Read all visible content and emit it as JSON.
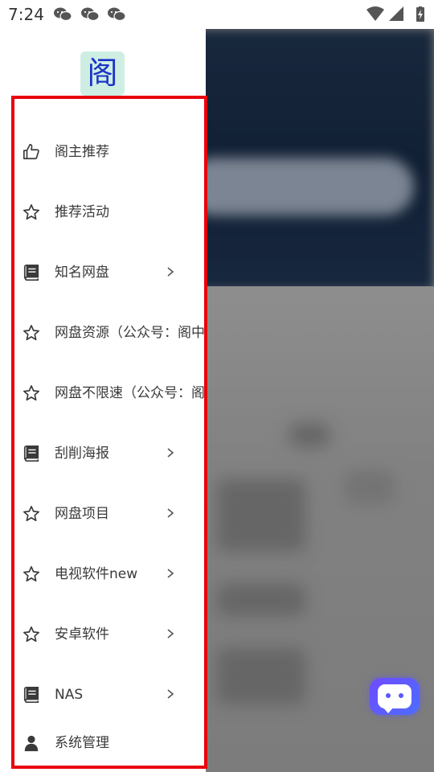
{
  "status_bar": {
    "time": "7:24",
    "notification_icons": [
      "wechat-icon",
      "wechat-icon",
      "wechat-icon"
    ],
    "system_icons": [
      "wifi-icon",
      "signal-icon",
      "battery-charging-icon"
    ]
  },
  "drawer": {
    "logo_text": "阁",
    "menu_items": [
      {
        "label": "阁主推荐",
        "icon": "thumbs-up-icon",
        "has_submenu": false
      },
      {
        "label": "推荐活动",
        "icon": "star-icon",
        "has_submenu": false
      },
      {
        "label": "知名网盘",
        "icon": "book-icon",
        "has_submenu": true
      },
      {
        "label": "网盘资源（公众号：阁中",
        "icon": "star-icon",
        "has_submenu": false
      },
      {
        "label": "网盘不限速（公众号：阁",
        "icon": "star-icon",
        "has_submenu": false
      },
      {
        "label": "刮削海报",
        "icon": "book-icon",
        "has_submenu": true
      },
      {
        "label": "网盘项目",
        "icon": "star-icon",
        "has_submenu": true
      },
      {
        "label": "电视软件new",
        "icon": "star-icon",
        "has_submenu": true
      },
      {
        "label": "安卓软件",
        "icon": "star-icon",
        "has_submenu": true
      },
      {
        "label": "NAS",
        "icon": "book-icon",
        "has_submenu": true
      },
      {
        "label": "系统管理",
        "icon": "user-icon",
        "has_submenu": false
      }
    ],
    "highlight_color": "#e8000d"
  },
  "floating_button": {
    "icon": "chat-bot-icon",
    "color": "#6f4bff"
  }
}
